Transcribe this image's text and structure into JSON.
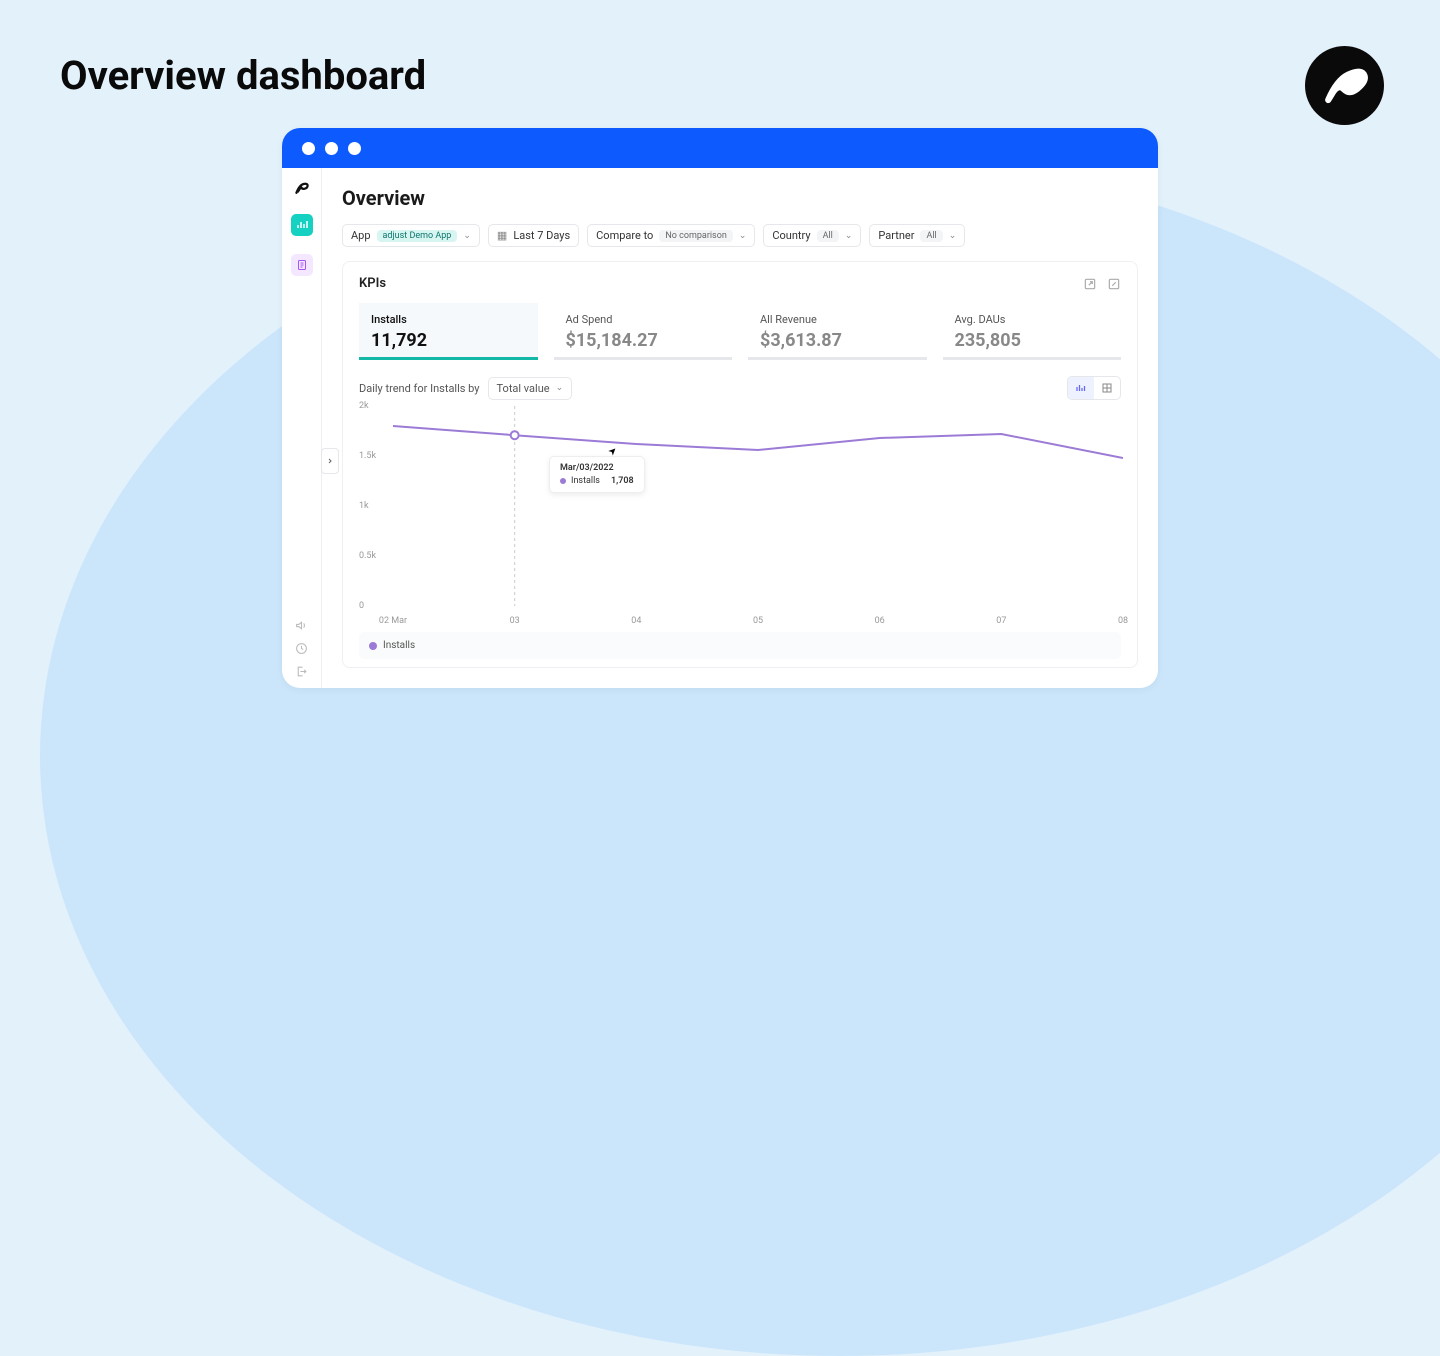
{
  "page": {
    "title": "Overview dashboard"
  },
  "app": {
    "title": "Overview",
    "filters": {
      "app_label": "App",
      "app_value": "adjust Demo App",
      "date_label": "Last 7 Days",
      "compare_label": "Compare to",
      "compare_value": "No comparison",
      "country_label": "Country",
      "country_value": "All",
      "partner_label": "Partner",
      "partner_value": "All"
    },
    "kpis_title": "KPIs",
    "kpis": [
      {
        "label": "Installs",
        "value": "11,792",
        "active": true
      },
      {
        "label": "Ad Spend",
        "value": "$15,184.27",
        "active": false
      },
      {
        "label": "All Revenue",
        "value": "$3,613.87",
        "active": false
      },
      {
        "label": "Avg. DAUs",
        "value": "235,805",
        "active": false
      }
    ],
    "trend_label": "Daily trend for Installs by",
    "trend_select": "Total value",
    "legend_label": "Installs",
    "tooltip": {
      "date": "Mar/03/2022",
      "series": "Installs",
      "value": "1,708"
    }
  },
  "chart_data": {
    "type": "line",
    "title": "Daily trend for Installs",
    "xlabel": "",
    "ylabel": "",
    "ylim": [
      0,
      2000
    ],
    "yticks": [
      "0",
      "0.5k",
      "1k",
      "1.5k",
      "2k"
    ],
    "categories": [
      "02 Mar",
      "03",
      "04",
      "05",
      "06",
      "07",
      "08"
    ],
    "series": [
      {
        "name": "Installs",
        "values": [
          1800,
          1708,
          1620,
          1560,
          1680,
          1720,
          1480
        ],
        "color": "#9b7bd6"
      }
    ],
    "highlight_index": 1
  }
}
